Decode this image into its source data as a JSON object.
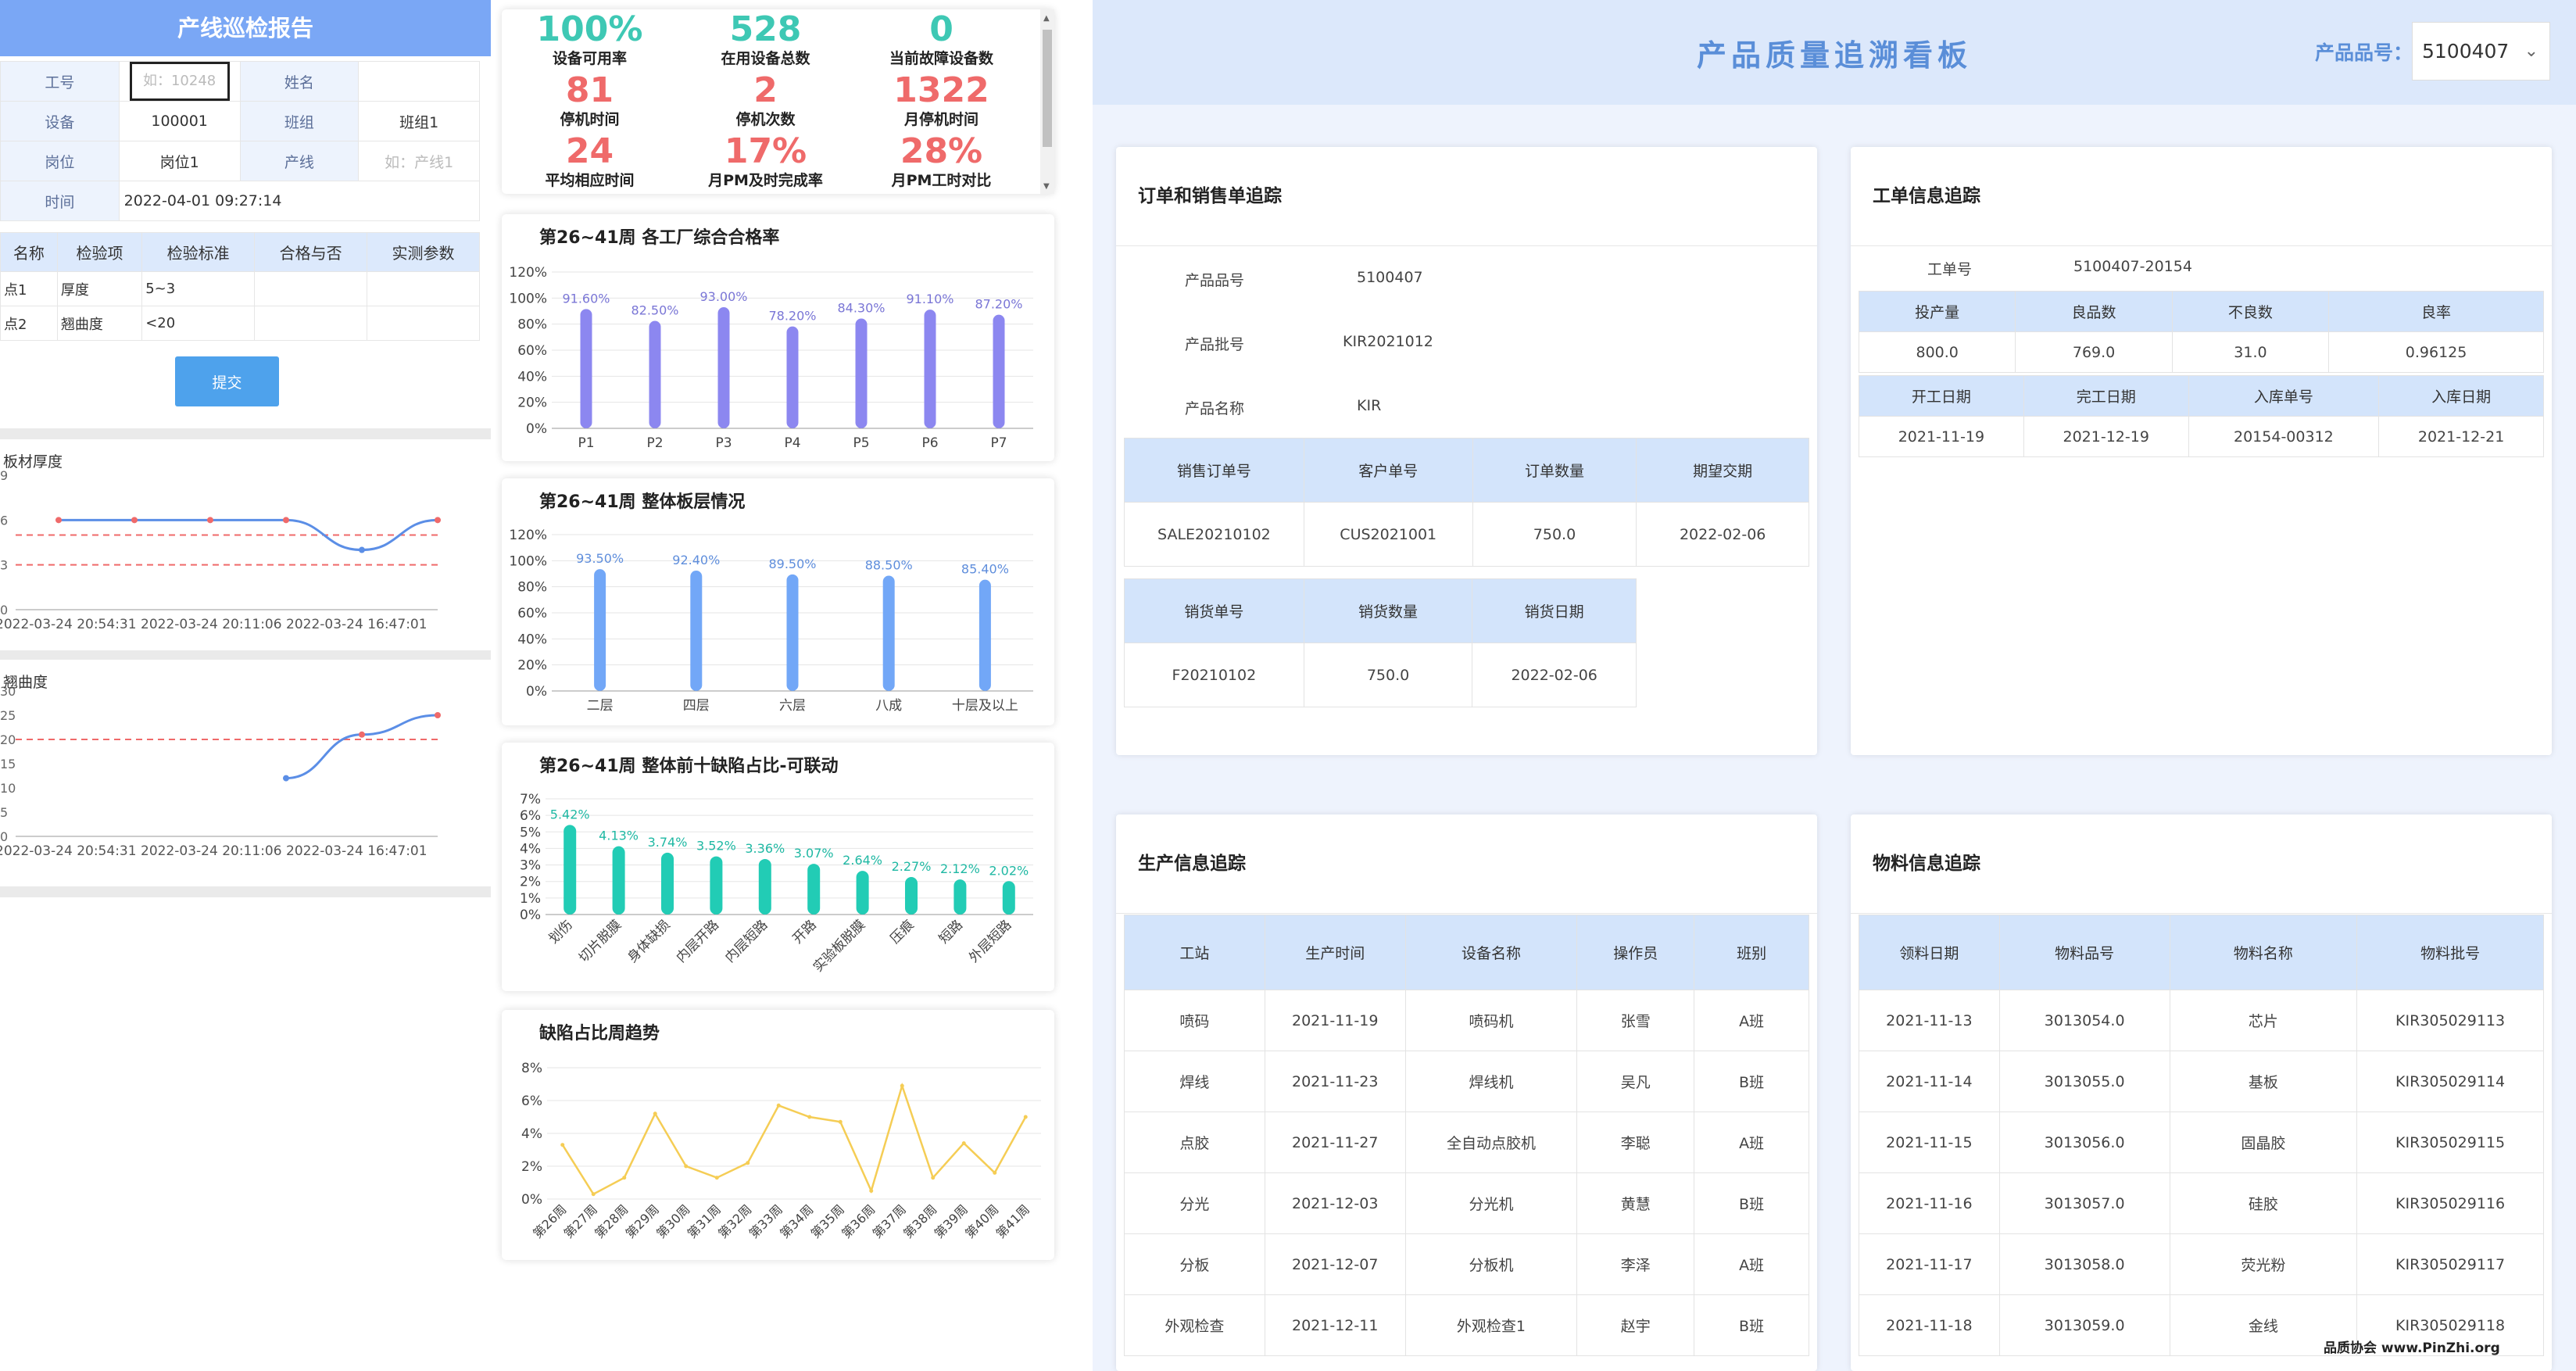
{
  "left": {
    "title": "产线巡检报告",
    "form": {
      "worker_no_label": "工号",
      "worker_no_placeholder": "如：10248",
      "name_label": "姓名",
      "device_label": "设备",
      "device_value": "100001",
      "team_label": "班组",
      "team_value": "班组1",
      "post_label": "岗位",
      "post_value": "岗位1",
      "line_label": "产线",
      "line_placeholder": "如：产线1",
      "time_label": "时间",
      "time_value": "2022-04-01 09:27:14"
    },
    "inspect_headers": [
      "名称",
      "检验项",
      "检验标准",
      "合格与否",
      "实测参数"
    ],
    "inspect_rows": [
      {
        "name": "点1",
        "item": "厚度",
        "std": "5~3",
        "ok": "",
        "val": ""
      },
      {
        "name": "点2",
        "item": "翘曲度",
        "std": "<20",
        "ok": "",
        "val": ""
      }
    ],
    "submit_label": "提交",
    "thickness_chart": {
      "title": "板材厚度",
      "y_ticks": [
        "9",
        "6",
        "3",
        "0"
      ],
      "x_ticks": [
        "2022-03-24 20:54:31",
        "2022-03-24 20:11:06",
        "2022-03-24 16:47:01"
      ]
    },
    "warp_chart": {
      "title": "翘曲度",
      "y_ticks": [
        "30",
        "25",
        "20",
        "15",
        "10",
        "5",
        "0"
      ],
      "x_ticks": [
        "2022-03-24 20:54:31",
        "2022-03-24 20:11:06",
        "2022-03-24 16:47:01"
      ]
    }
  },
  "kpis": [
    {
      "value": "100%",
      "label": "设备可用率",
      "tone": "g"
    },
    {
      "value": "528",
      "label": "在用设备总数",
      "tone": "g"
    },
    {
      "value": "0",
      "label": "当前故障设备数",
      "tone": "g"
    },
    {
      "value": "81",
      "label": "停机时间",
      "tone": "r"
    },
    {
      "value": "2",
      "label": "停机次数",
      "tone": "r"
    },
    {
      "value": "1322",
      "label": "月停机时间",
      "tone": "r"
    },
    {
      "value": "24",
      "label": "平均相应时间",
      "tone": "r"
    },
    {
      "value": "17%",
      "label": "月PM及时完成率",
      "tone": "r"
    },
    {
      "value": "28%",
      "label": "月PM工时对比",
      "tone": "r"
    }
  ],
  "chart_data": [
    {
      "type": "line",
      "title": "板材厚度",
      "x": [
        "2022-03-24 20:54:31",
        "2022-03-24 20:11:06",
        "2022-03-24 16:47:01"
      ],
      "ylim": [
        0,
        9
      ],
      "y_ticks": [
        0,
        3,
        6,
        9
      ],
      "series": [
        {
          "values": [
            6,
            6,
            6,
            6,
            4,
            6
          ]
        }
      ],
      "limits": [
        5,
        3
      ],
      "color": "#5b8ee6"
    },
    {
      "type": "line",
      "title": "翘曲度",
      "x": [
        "2022-03-24 20:54:31",
        "2022-03-24 20:11:06",
        "2022-03-24 16:47:01"
      ],
      "ylim": [
        0,
        30
      ],
      "y_ticks": [
        0,
        5,
        10,
        15,
        20,
        25,
        30
      ],
      "series": [
        {
          "values": [
            null,
            null,
            null,
            12,
            21,
            25
          ]
        }
      ],
      "limits": [
        20
      ],
      "color": "#5b8ee6"
    },
    {
      "type": "bar",
      "title": "第26~41周 各工厂综合合格率",
      "categories": [
        "P1",
        "P2",
        "P3",
        "P4",
        "P5",
        "P6",
        "P7"
      ],
      "values": [
        91.6,
        82.5,
        93.0,
        78.2,
        84.3,
        91.1,
        87.2
      ],
      "labels": [
        "91.60%",
        "82.50%",
        "93.00%",
        "78.20%",
        "84.30%",
        "91.10%",
        "87.20%"
      ],
      "ylim": [
        0,
        120
      ],
      "y_ticks": [
        "0%",
        "20%",
        "40%",
        "60%",
        "80%",
        "100%",
        "120%"
      ],
      "color": "#8c87f0",
      "label_color": "#7a76d6"
    },
    {
      "type": "bar",
      "title": "第26~41周 整体板层情况",
      "categories": [
        "二层",
        "四层",
        "六层",
        "八成",
        "十层及以上"
      ],
      "values": [
        93.5,
        92.4,
        89.5,
        88.5,
        85.4
      ],
      "labels": [
        "93.50%",
        "92.40%",
        "89.50%",
        "88.50%",
        "85.40%"
      ],
      "ylim": [
        0,
        120
      ],
      "y_ticks": [
        "0%",
        "20%",
        "40%",
        "60%",
        "80%",
        "100%",
        "120%"
      ],
      "color": "#72a7f7",
      "label_color": "#5f8edc"
    },
    {
      "type": "bar",
      "title": "第26~41周 整体前十缺陷占比-可联动",
      "categories": [
        "划伤",
        "切片脱膜",
        "身体缺损",
        "内层开路",
        "内层短路",
        "开路",
        "实验板脱膜",
        "压痕",
        "短路",
        "外层短路"
      ],
      "values": [
        5.42,
        4.13,
        3.74,
        3.52,
        3.36,
        3.07,
        2.64,
        2.27,
        2.12,
        2.02
      ],
      "labels": [
        "5.42%",
        "4.13%",
        "3.74%",
        "3.52%",
        "3.36%",
        "3.07%",
        "2.64%",
        "2.27%",
        "2.12%",
        "2.02%"
      ],
      "ylim": [
        0,
        7
      ],
      "y_ticks": [
        "0%",
        "1%",
        "2%",
        "3%",
        "4%",
        "5%",
        "6%",
        "7%"
      ],
      "color": "#22ccb5",
      "label_color": "#1fb8a3",
      "rotate": true
    },
    {
      "type": "line",
      "title": "缺陷占比周趋势",
      "categories": [
        "第26周",
        "第27周",
        "第28周",
        "第29周",
        "第30周",
        "第31周",
        "第32周",
        "第33周",
        "第34周",
        "第35周",
        "第36周",
        "第37周",
        "第38周",
        "第39周",
        "第40周",
        "第41周"
      ],
      "values": [
        3.3,
        0.3,
        1.3,
        5.2,
        2.0,
        1.3,
        2.2,
        5.7,
        5.0,
        4.7,
        0.5,
        6.9,
        1.3,
        3.4,
        1.6,
        5.0
      ],
      "ylim": [
        0,
        8
      ],
      "y_ticks": [
        "0%",
        "2%",
        "4%",
        "6%",
        "8%"
      ],
      "color": "#f5cd55"
    }
  ],
  "right": {
    "title": "产品质量追溯看板",
    "product_label": "产品品号：",
    "product_value": "5100407",
    "order": {
      "title": "订单和销售单追踪",
      "kv": [
        [
          "产品品号",
          "5100407"
        ],
        [
          "产品批号",
          "KIR2021012"
        ],
        [
          "产品名称",
          "KIR"
        ]
      ],
      "sales_headers": [
        "销售订单号",
        "客户单号",
        "订单数量",
        "期望交期"
      ],
      "sales_row": [
        "SALE20210102",
        "CUS2021001",
        "750.0",
        "2022-02-06"
      ],
      "ship_headers": [
        "销货单号",
        "销货数量",
        "销货日期"
      ],
      "ship_row": [
        "F20210102",
        "750.0",
        "2022-02-06"
      ]
    },
    "workorder": {
      "title": "工单信息追踪",
      "no_label": "工单号",
      "no_value": "5100407-20154",
      "h1": [
        "投产量",
        "良品数",
        "不良数",
        "良率"
      ],
      "r1": [
        "800.0",
        "769.0",
        "31.0",
        "0.96125"
      ],
      "h2": [
        "开工日期",
        "完工日期",
        "入库单号",
        "入库日期"
      ],
      "r2": [
        "2021-11-19",
        "2021-12-19",
        "20154-00312",
        "2021-12-21"
      ]
    },
    "production": {
      "title": "生产信息追踪",
      "headers": [
        "工站",
        "生产时间",
        "设备名称",
        "操作员",
        "班别"
      ],
      "rows": [
        [
          "喷码",
          "2021-11-19",
          "喷码机",
          "张雪",
          "A班"
        ],
        [
          "焊线",
          "2021-11-23",
          "焊线机",
          "吴凡",
          "B班"
        ],
        [
          "点胶",
          "2021-11-27",
          "全自动点胶机",
          "李聪",
          "A班"
        ],
        [
          "分光",
          "2021-12-03",
          "分光机",
          "黄慧",
          "B班"
        ],
        [
          "分板",
          "2021-12-07",
          "分板机",
          "李泽",
          "A班"
        ],
        [
          "外观检查",
          "2021-12-11",
          "外观检查1",
          "赵宇",
          "B班"
        ]
      ]
    },
    "material": {
      "title": "物料信息追踪",
      "headers": [
        "领料日期",
        "物料品号",
        "物料名称",
        "物料批号"
      ],
      "rows": [
        [
          "2021-11-13",
          "3013054.0",
          "芯片",
          "KIR305029113"
        ],
        [
          "2021-11-14",
          "3013055.0",
          "基板",
          "KIR305029114"
        ],
        [
          "2021-11-15",
          "3013056.0",
          "固晶胶",
          "KIR305029115"
        ],
        [
          "2021-11-16",
          "3013057.0",
          "硅胶",
          "KIR305029116"
        ],
        [
          "2021-11-17",
          "3013058.0",
          "荧光粉",
          "KIR305029117"
        ],
        [
          "2021-11-18",
          "3013059.0",
          "金线",
          "KIR305029118"
        ]
      ]
    }
  },
  "watermark": "品质协会 www.PinZhi.org"
}
